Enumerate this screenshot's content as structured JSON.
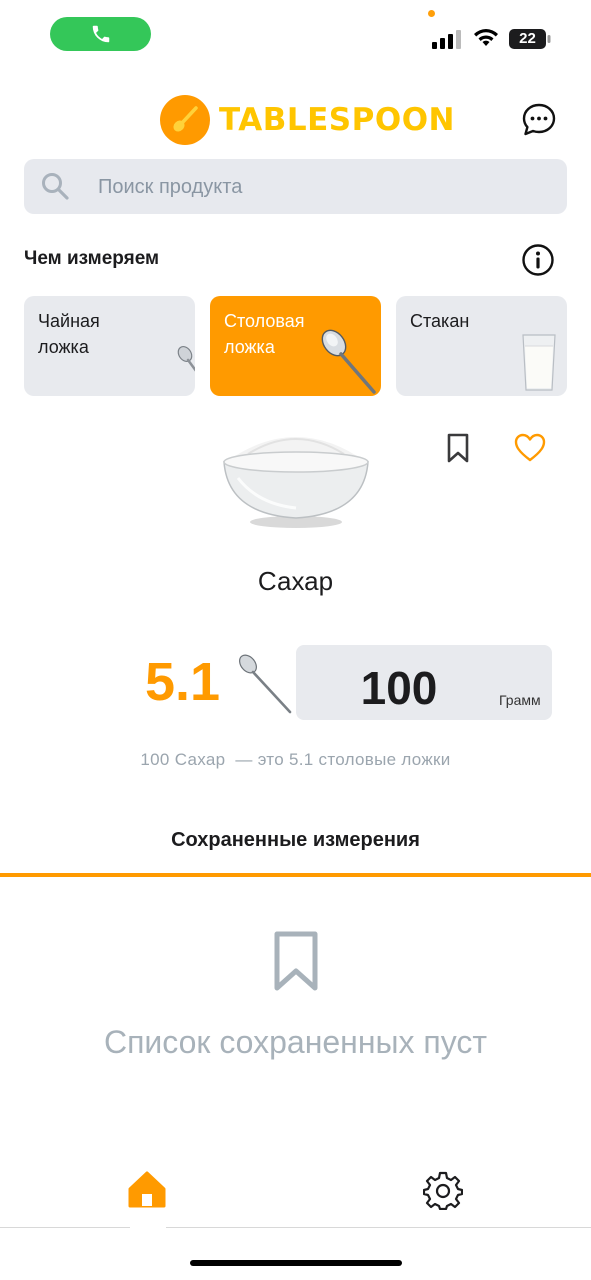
{
  "status_bar": {
    "battery_level": "22"
  },
  "header": {
    "logo_text": "TABLESPOON"
  },
  "search": {
    "placeholder": "Поиск продукта"
  },
  "measure": {
    "title": "Чем измеряем",
    "options": [
      {
        "label": "Чайная ложка",
        "active": false
      },
      {
        "label": "Столовая ложка",
        "active": true
      },
      {
        "label": "Стакан",
        "active": false
      }
    ]
  },
  "product": {
    "name": "Сахар",
    "result_value": "5.1",
    "quantity": "100",
    "unit": "Грамм",
    "summary": "100 Сахар  — это 5.1 столовые ложки"
  },
  "saved": {
    "tab_label": "Сохраненные измерения",
    "empty_text": "Список сохраненных пуст"
  },
  "colors": {
    "accent": "#ff9a00",
    "logo": "#ffc500",
    "call": "#34c759",
    "card_bg": "#e8eaee"
  }
}
